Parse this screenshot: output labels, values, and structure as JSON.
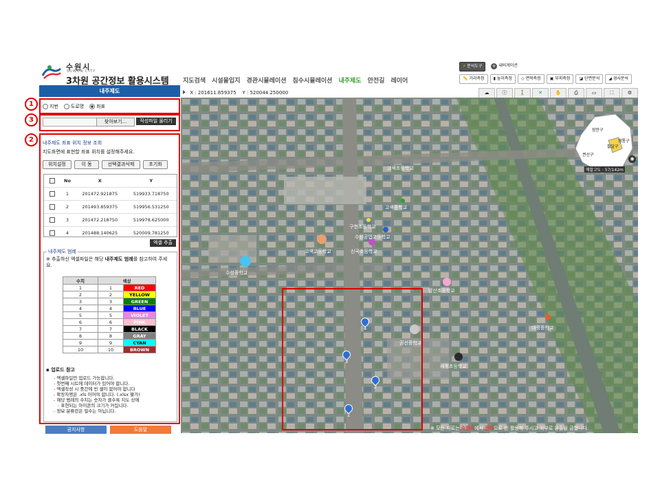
{
  "header": {
    "city_kr": "수원시",
    "city_en": "SUWON CITY",
    "title": "3차원 공간정보 활용시스템",
    "menu": [
      "지도검색",
      "시설물입지",
      "경관시뮬레이션",
      "침수시뮬레이션",
      "내주제도",
      "안전길",
      "레이어"
    ],
    "active_menu_index": 4,
    "top_tools": [
      "분석도구",
      "내비게이션"
    ],
    "measure_tools": [
      "거리측정",
      "높이측정",
      "면적측정",
      "부피측정",
      "단면분석",
      "경사분석"
    ]
  },
  "panel": {
    "header": "내주제도",
    "markers": [
      "1",
      "3",
      "2"
    ],
    "radios": [
      {
        "label": "지번",
        "checked": false
      },
      {
        "label": "도로명",
        "checked": false
      },
      {
        "label": "좌표",
        "checked": true
      }
    ],
    "browse_label": "찾아보기...",
    "upload_label": "작성파일 올리기",
    "section_title": "내주제도 좌표 위치 정보 조회",
    "section_desc": "지도화면에 표현할 좌표 위치를 설정해주세요.",
    "buttons": [
      "위치설정",
      "이 동",
      "선택결과삭제",
      "초기화"
    ],
    "table_headers": [
      "No",
      "X",
      "Y"
    ],
    "rows": [
      {
        "no": "1",
        "x": "201472.921875",
        "y": "519933.718750"
      },
      {
        "no": "2",
        "x": "201493.859375",
        "y": "519956.531250"
      },
      {
        "no": "3",
        "x": "201472.218750",
        "y": "519978.625000"
      },
      {
        "no": "4",
        "x": "201488.140625",
        "y": "520009.781250"
      }
    ],
    "excel_label": "엑셀 추출",
    "legend_title": "내주제도 범례",
    "legend_note_prefix": "※ 추출하신 엑셀파일은 해당 ",
    "legend_note_bold": "내주제도 범례",
    "legend_note_suffix": "를 참고하여 주세요.",
    "legend_headers": [
      "수치",
      "색상"
    ],
    "legend": [
      {
        "value": "1",
        "code": "1",
        "color": "RED",
        "hex": "#ff0000",
        "text": "#ffffff"
      },
      {
        "value": "2",
        "code": "2",
        "color": "YELLOW",
        "hex": "#ffff00",
        "text": "#000000"
      },
      {
        "value": "3",
        "code": "3",
        "color": "GREEN",
        "hex": "#008000",
        "text": "#ffffff"
      },
      {
        "value": "4",
        "code": "4",
        "color": "BLUE",
        "hex": "#0000ff",
        "text": "#ffffff"
      },
      {
        "value": "5",
        "code": "5",
        "color": "VIOLET",
        "hex": "#ee82ee",
        "text": "#ffffff"
      },
      {
        "value": "6",
        "code": "6",
        "color": "PINK",
        "hex": "#ffc0cb",
        "text": "#ffffff"
      },
      {
        "value": "7",
        "code": "7",
        "color": "BLACK",
        "hex": "#000000",
        "text": "#ffffff"
      },
      {
        "value": "8",
        "code": "8",
        "color": "GRAY",
        "hex": "#808080",
        "text": "#ffffff"
      },
      {
        "value": "9",
        "code": "9",
        "color": "CYAN",
        "hex": "#00ffff",
        "text": "#000000"
      },
      {
        "value": "10",
        "code": "10",
        "color": "BROWN",
        "hex": "#a52a2a",
        "text": "#ffffff"
      }
    ],
    "upload_ref_title": "업로드 참고",
    "upload_notes": [
      "엑셀파일만 업로드 가능합니다.",
      "첫번째 시트에 데이터가 있어야 합니다.",
      "엑셀작성 시 중간에 빈 셀이 없어야 합니다",
      "확장자명은 .xls 이어야 합니다. (.xlsx 불가)",
      "해당 범례의 수치는 숫자가 클수록 지도 상에",
      "표현되는 아이콘의 크기가 커집니다.",
      "정보 분류란은 필수는 아닙니다."
    ]
  },
  "coords": {
    "x_label": "X :",
    "x": "201611.859375",
    "y_label": "Y :",
    "y": "520044.250000"
  },
  "map": {
    "schools": [
      "고색초등학교",
      "고색중학교",
      "구현초등학교",
      "수원공업고등학교",
      "고색고등학교",
      "신곡초등학교",
      "수성중학교",
      "발산초등학교",
      "권선중학교",
      "세평초등학교",
      "대평중학교"
    ],
    "pins": [
      "4",
      "3",
      "2",
      "1"
    ],
    "minimap": {
      "labels": [
        "장안구",
        "팔달구",
        "영통구",
        "권선구"
      ],
      "altitude": "해발고도 : 57/142m"
    },
    "copyright_prefix": "※ 모든 자료는 ",
    "copyright_red1": "수원시",
    "copyright_mid": "에서 ",
    "copyright_red2": "관리",
    "copyright_suffix": "으로 만 활용해 주시고 외부로 유출을 금합니다."
  },
  "footer": {
    "notice": "공지사항",
    "help": "도움말"
  }
}
